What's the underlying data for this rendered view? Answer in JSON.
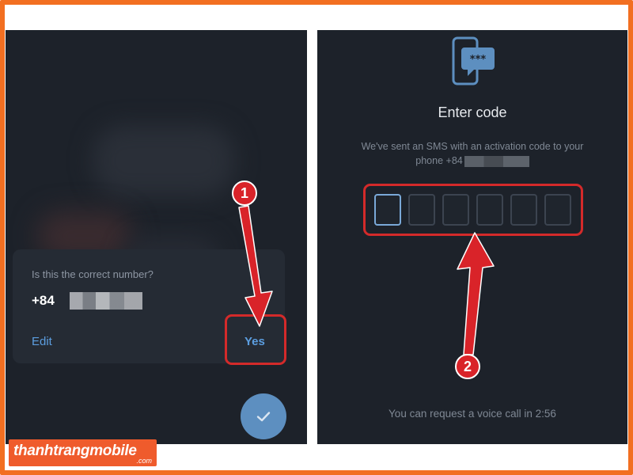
{
  "left_screen": {
    "dialog": {
      "question": "Is this the correct number?",
      "number_prefix": "+84",
      "edit_label": "Edit",
      "yes_label": "Yes"
    },
    "fab_icon": "check-icon"
  },
  "right_screen": {
    "header_icon": "sms-phone-icon",
    "title": "Enter code",
    "description_line1": "We've sent an SMS with an activation code to your",
    "description_line2_prefix": "phone +84",
    "code_box_count": 6,
    "voice_call_text": "You can request a voice call in 2:56"
  },
  "annotations": {
    "step1": "1",
    "step2": "2",
    "highlight_color": "#d42a2a"
  },
  "watermark": {
    "brand": "thanhtrangmobile",
    "suffix": ".com"
  },
  "colors": {
    "frame": "#f26f21",
    "panel_bg": "#1d222a",
    "link": "#5c9ee0",
    "fab": "#5d8fc0"
  }
}
